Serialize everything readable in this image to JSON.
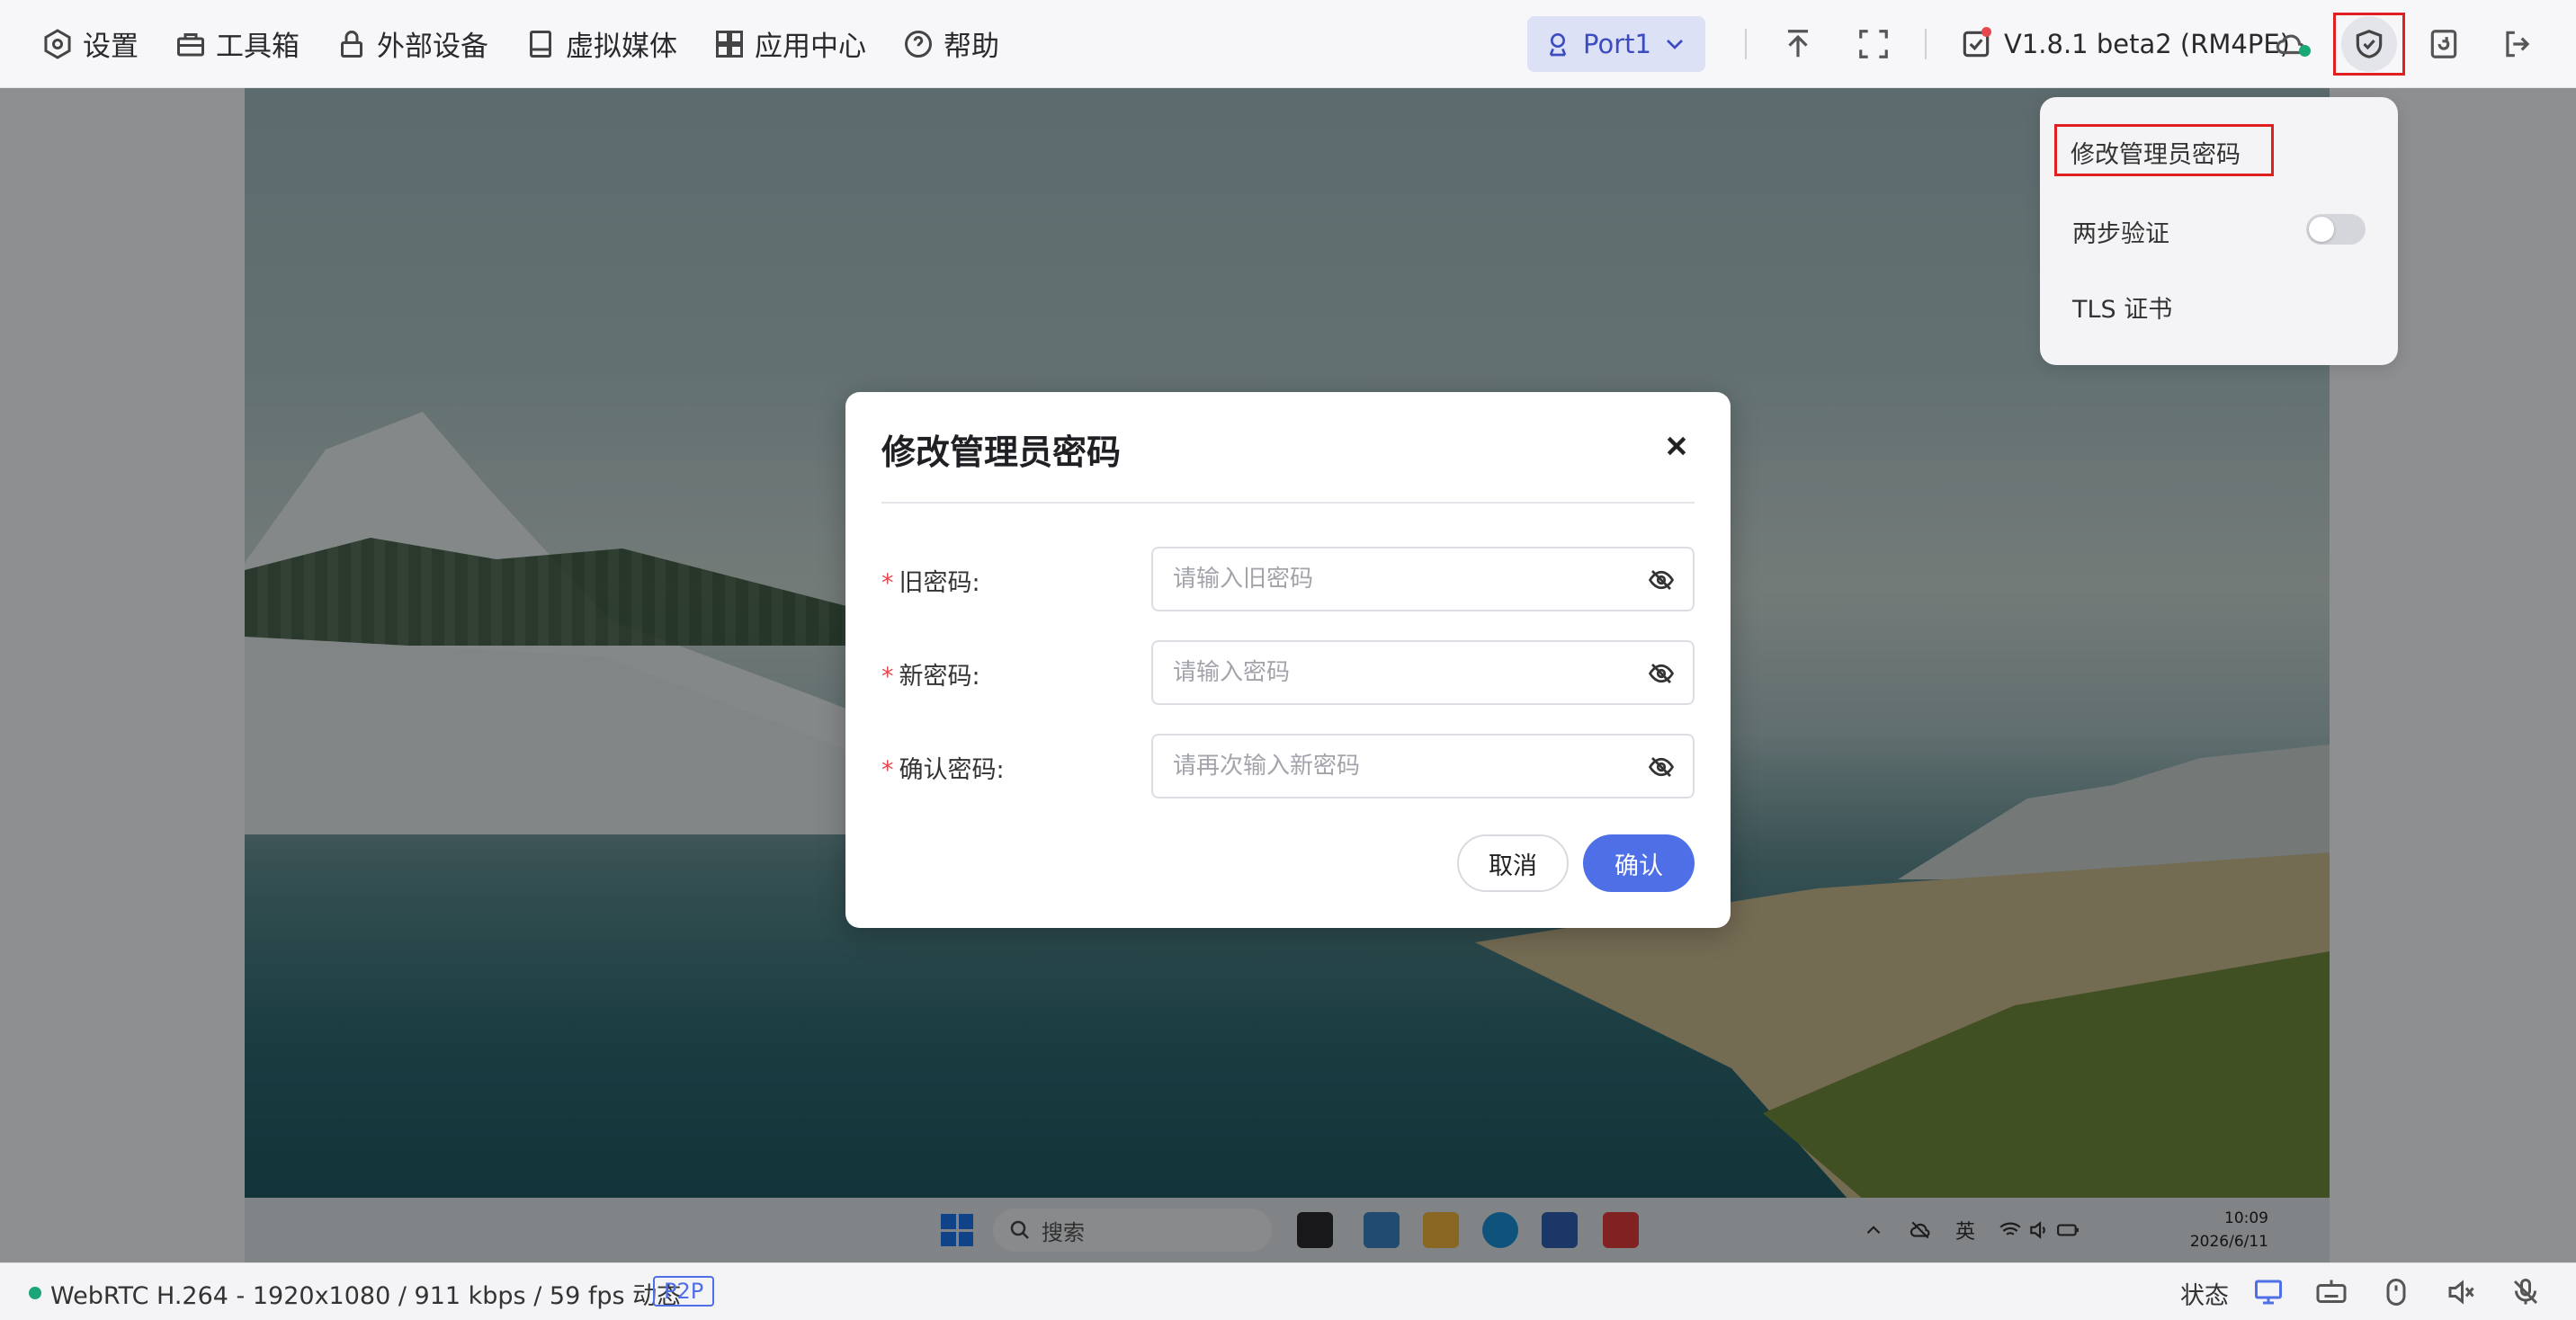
{
  "topbar": {
    "menu": [
      {
        "label": "设置",
        "icon": "settings-icon"
      },
      {
        "label": "工具箱",
        "icon": "toolbox-icon"
      },
      {
        "label": "外部设备",
        "icon": "lock-icon"
      },
      {
        "label": "虚拟媒体",
        "icon": "disk-icon"
      },
      {
        "label": "应用中心",
        "icon": "apps-icon"
      },
      {
        "label": "帮助",
        "icon": "help-icon"
      }
    ],
    "port": "Port1",
    "version": "V1.8.1 beta2 (RM4PE)"
  },
  "dropdown": {
    "items": [
      "修改管理员密码",
      "两步验证",
      "TLS 证书"
    ],
    "two_step_enabled": false
  },
  "modal": {
    "title": "修改管理员密码",
    "fields": [
      {
        "label": "旧密码",
        "placeholder": "请输入旧密码",
        "value": ""
      },
      {
        "label": "新密码",
        "placeholder": "请输入密码",
        "value": ""
      },
      {
        "label": "确认密码",
        "placeholder": "请再次输入新密码",
        "value": ""
      }
    ],
    "required_mark": "*",
    "colon": ":",
    "cancel": "取消",
    "confirm": "确认"
  },
  "taskbar": {
    "search": "搜索",
    "ime": "英",
    "time": "10:09",
    "date": "2026/6/11"
  },
  "statusbar": {
    "stream": "WebRTC H.264 - 1920x1080 / 911 kbps / 59 fps 动态",
    "mode": "P2P",
    "status": "状态"
  },
  "colors": {
    "accent": "#4e6fe6",
    "highlight": "#e02020",
    "required": "#e5484d",
    "online": "#1aa57a"
  }
}
